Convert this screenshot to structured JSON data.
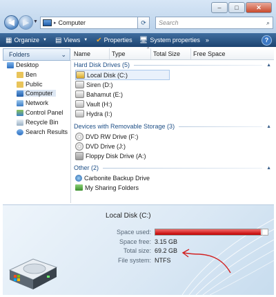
{
  "window": {
    "minimize": "–",
    "maximize": "□",
    "close": "✕"
  },
  "address": {
    "path": "Computer",
    "search_placeholder": "Search"
  },
  "toolbar": {
    "organize": "Organize",
    "views": "Views",
    "properties": "Properties",
    "system_properties": "System properties",
    "more": "»",
    "help": "?"
  },
  "folders_header": "Folders",
  "columns": {
    "name": "Name",
    "type": "Type",
    "total_size": "Total Size",
    "free_space": "Free Space"
  },
  "tree": [
    "Desktop",
    "Ben",
    "Public",
    "Computer",
    "Network",
    "Control Panel",
    "Recycle Bin",
    "Search Results"
  ],
  "groups": {
    "hdd": "Hard Disk Drives (5)",
    "removable": "Devices with Removable Storage (3)",
    "other": "Other (2)"
  },
  "hard_drives": [
    "Local Disk (C:)",
    "Siren (D:)",
    "Bahamut (E:)",
    "Vault (H:)",
    "Hydra (I:)"
  ],
  "removable": [
    "DVD RW Drive (F:)",
    "DVD Drive (J:)",
    "Floppy Disk Drive (A:)"
  ],
  "other": [
    "Carbonite Backup Drive",
    "My Sharing Folders"
  ],
  "details": {
    "drive_name": "Local Disk (C:)",
    "space_used_label": "Space used:",
    "space_free_label": "Space free:",
    "space_free_value": "3.15 GB",
    "total_size_label": "Total size:",
    "total_size_value": "69.2 GB",
    "file_system_label": "File system:",
    "file_system_value": "NTFS",
    "used_fraction": 0.954
  },
  "colors": {
    "accent": "#1d4e86",
    "toolbar": "#2b5785",
    "used_bar": "#c10000",
    "annotation": "#d22020"
  },
  "icons": [
    "back-arrow-icon",
    "forward-arrow-icon",
    "computer-icon",
    "refresh-icon",
    "search-icon",
    "organize-icon",
    "views-icon",
    "properties-check-icon",
    "system-properties-icon",
    "help-icon",
    "hard-drive-icon",
    "dvd-drive-icon",
    "floppy-icon",
    "carbonite-icon",
    "sharing-folder-icon"
  ]
}
